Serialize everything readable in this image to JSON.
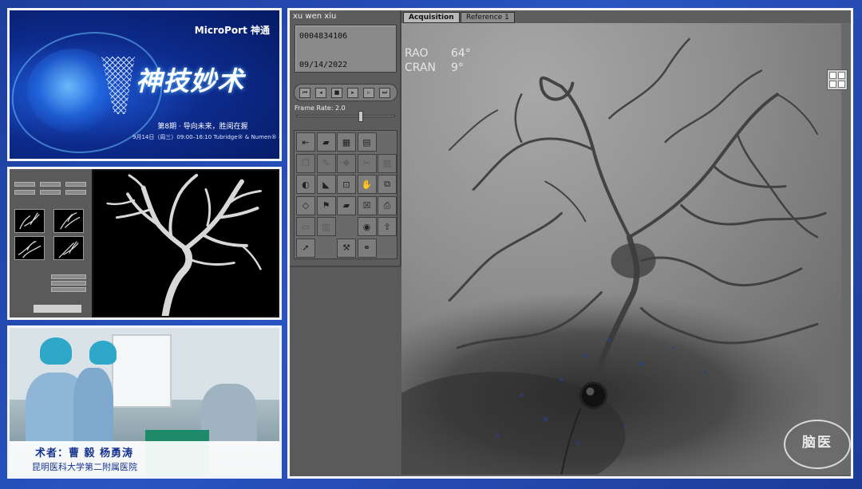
{
  "banner": {
    "brand": "MicroPort 神通",
    "title": "神技妙术",
    "subtitle": "第8期 · 导向未来，胜阅在握",
    "schedule": "9月14日（周三）09:00–16:10 Tubridge® & Numen® 手术直播"
  },
  "surgery_caption": {
    "surgeons": "术者：曹 毅 杨勇涛",
    "hospital": "昆明医科大学第二附属医院"
  },
  "viewer": {
    "patient_name": "xu wen xiu",
    "patient_id": "0004834106",
    "date": "09/14/2022",
    "frame_rate_label": "Frame Rate: 2.0",
    "frame_rate_fraction": 0.66,
    "tabs": [
      {
        "label": "Acquisition",
        "active": true
      },
      {
        "label": "Reference 1",
        "active": false
      }
    ],
    "projection": [
      {
        "name": "RAO",
        "value": "64°"
      },
      {
        "name": "CRAN",
        "value": "9°"
      }
    ],
    "transport_icons": [
      "first-frame-icon",
      "step-back-icon",
      "stop-icon",
      "play-icon",
      "step-forward-icon",
      "last-frame-icon"
    ],
    "tools": [
      [
        "roadmap-icon",
        "folder-icon",
        "film-strip-icon",
        "grid-icon",
        ""
      ],
      [
        "copy-icon",
        "edit-icon",
        "move-icon",
        "scissors-icon",
        "page-icon"
      ],
      [
        "window-level-icon",
        "sharpen-icon",
        "zoom-icon",
        "hand-icon",
        "compare-icon"
      ],
      [
        "rotate-icon",
        "flag-icon",
        "folder-icon",
        "close-box-icon",
        "print-icon"
      ],
      [
        "measure-icon",
        "ruler-icon",
        "",
        "camera-icon",
        "export-icon"
      ],
      [
        "pointer-icon",
        "",
        "wrench-icon",
        "link-icon",
        ""
      ]
    ],
    "tool_glyphs": {
      "roadmap-icon": "⇤",
      "folder-icon": "▰",
      "film-strip-icon": "▦",
      "grid-icon": "▤",
      "copy-icon": "❐",
      "edit-icon": "✎",
      "move-icon": "✥",
      "scissors-icon": "✂",
      "page-icon": "▧",
      "window-level-icon": "◐",
      "sharpen-icon": "◣",
      "zoom-icon": "⊡",
      "hand-icon": "✋",
      "compare-icon": "⧉",
      "rotate-icon": "◇",
      "flag-icon": "⚑",
      "close-box-icon": "☒",
      "print-icon": "⎙",
      "measure-icon": "▭",
      "ruler-icon": "▥",
      "camera-icon": "◉",
      "export-icon": "⇪",
      "pointer-icon": "➚",
      "wrench-icon": "⚒",
      "link-icon": "⚭"
    }
  },
  "watermark": "脑医",
  "colors": {
    "background": "#2a54c2",
    "banner_text": "#ffffff",
    "caption_text": "#17338f",
    "panel_gray": "#5c5c5c"
  }
}
